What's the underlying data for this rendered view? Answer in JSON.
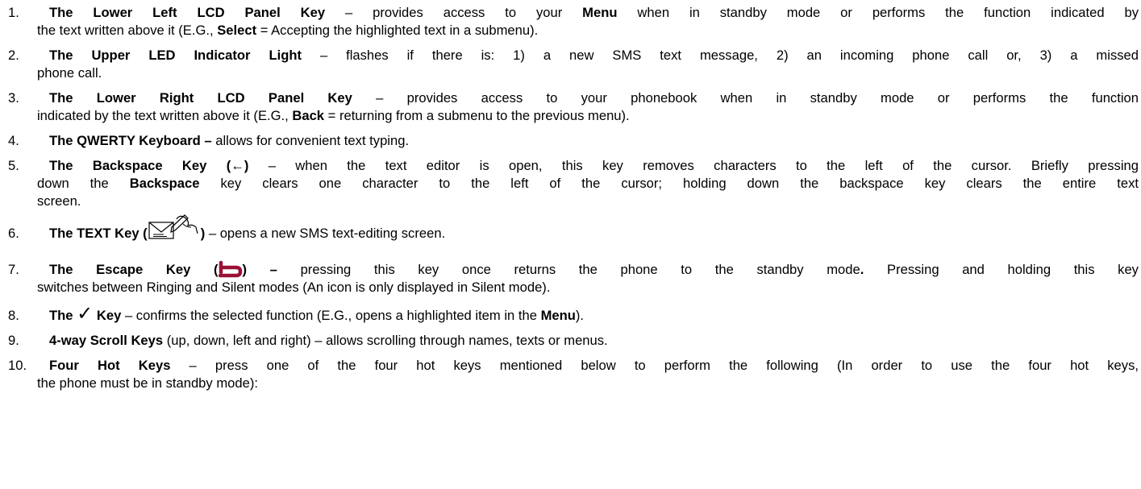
{
  "items": [
    {
      "num": "1.",
      "title": "The Lower Left LCD Panel Key",
      "l1_a": " – provides access to your ",
      "l1_b": "Menu",
      "l1_c": " when in standby mode or performs the function indicated by",
      "l2_a": "the text written above it (E.G., ",
      "l2_b": "Select",
      "l2_c": " = Accepting the highlighted text in a submenu)."
    },
    {
      "num": "2.",
      "title": "The Upper LED Indicator Light",
      "l1_a": " – flashes if there is: 1) a new SMS text message, 2) an incoming phone call or, 3) a missed",
      "l2_a": "phone call."
    },
    {
      "num": "3.",
      "title": "The Lower Right LCD Panel Key",
      "l1_a": " – provides access to your phonebook when in standby mode or performs the function",
      "l2_a": "indicated by the text written above it (E.G., ",
      "l2_b": "Back",
      "l2_c": " = returning from a submenu to the previous menu)."
    },
    {
      "num": "4.",
      "title": "The QWERTY Keyboard –",
      "l1_a": " allows for convenient text typing."
    },
    {
      "num": "5.",
      "title": "The Backspace Key (",
      "title_arrow": "←",
      "title_end": ")",
      "l1_a": " – when the text editor is open, this key removes characters to the left of the cursor. Briefly pressing",
      "l2_a": "down the ",
      "l2_b": "Backspace",
      "l2_c": " key clears one character to the left of the cursor; holding down the backspace key clears the entire text",
      "l3_a": "screen."
    },
    {
      "num": "6.",
      "title": "The TEXT Key (",
      "title_end": ")",
      "icon": "text-key-icon",
      "l1_a": " – opens a new SMS text-editing screen."
    },
    {
      "num": "7.",
      "title": "The Escape Key (",
      "title_end": ") –",
      "icon": "escape-key-icon",
      "l1_a": " pressing this key once returns the phone to the standby mode",
      "l1_b": ".",
      "l1_c": " Pressing and holding this key",
      "l2_a": "switches between Ringing and Silent modes (An icon is only displayed in Silent mode)."
    },
    {
      "num": "8.",
      "title": "The",
      "title_check": "✓",
      "title_end": "Key",
      "l1_a": " – confirms the selected function (E.G., opens a highlighted item in the ",
      "l1_b": "Menu",
      "l1_c": ")."
    },
    {
      "num": "9.",
      "title": "4-way Scroll Keys",
      "l1_a": " (up, down, left and right) – allows scrolling through names, texts or menus."
    },
    {
      "num": "10.",
      "title": "Four Hot Keys",
      "l1_a": " – press one of the four hot keys mentioned below to perform the following (In order to use the four hot keys,",
      "l2_a": "the phone must be in standby mode):"
    }
  ],
  "colors": {
    "escape_icon": "#9b1035"
  }
}
